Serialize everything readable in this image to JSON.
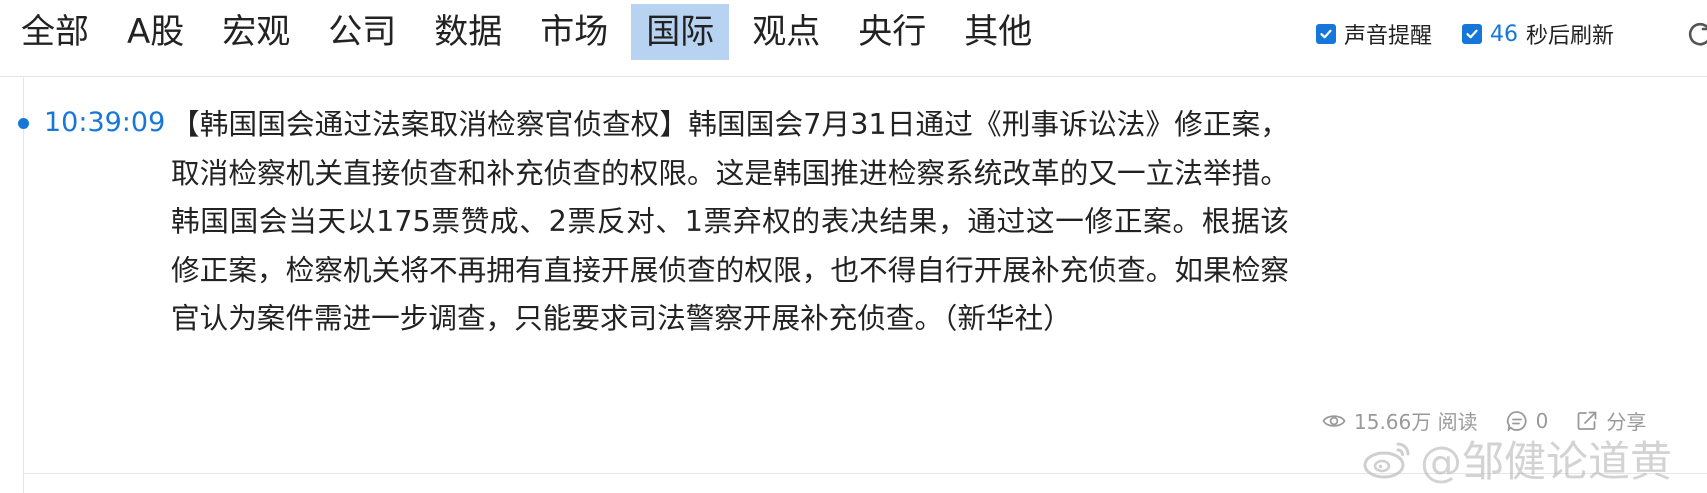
{
  "nav": {
    "tabs": [
      {
        "label": "全部",
        "active": false
      },
      {
        "label": "A股",
        "active": false
      },
      {
        "label": "宏观",
        "active": false
      },
      {
        "label": "公司",
        "active": false
      },
      {
        "label": "数据",
        "active": false
      },
      {
        "label": "市场",
        "active": false
      },
      {
        "label": "国际",
        "active": true
      },
      {
        "label": "观点",
        "active": false
      },
      {
        "label": "央行",
        "active": false
      },
      {
        "label": "其他",
        "active": false
      }
    ]
  },
  "controls": {
    "sound_alert": {
      "label": "声音提醒",
      "checked": true
    },
    "auto_refresh": {
      "countdown": "46",
      "label": "秒后刷新",
      "checked": true
    },
    "refresh_icon": "refresh-icon"
  },
  "news": {
    "time": "10:39:09",
    "content": "【韩国国会通过法案取消检察官侦查权】韩国国会7月31日通过《刑事诉讼法》修正案，取消检察机关直接侦查和补充侦查的权限。这是韩国推进检察系统改革的又一立法举措。韩国国会当天以175票赞成、2票反对、1票弃权的表决结果，通过这一修正案。根据该修正案，检察机关将不再拥有直接开展侦查的权限，也不得自行开展补充侦查。如果检察官认为案件需进一步调查，只能要求司法警察开展补充侦查。（新华社）",
    "views": "15.66万 阅读",
    "comments": "0",
    "share": "分享"
  },
  "watermark": {
    "text": "@邹健论道黄",
    "icon": "weibo-icon"
  },
  "colors": {
    "accent": "#1677d9",
    "active_tab_bg": "#b8d3f2",
    "muted": "#9a9a9a",
    "divider": "#e6e6e6"
  }
}
